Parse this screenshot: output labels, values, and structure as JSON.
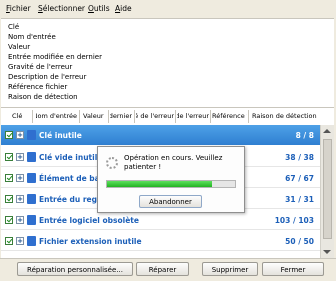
{
  "menu": {
    "fichier": {
      "first": "F",
      "rest": "ichier"
    },
    "selectionner": {
      "first": "S",
      "rest": "électionner"
    },
    "outils": {
      "first": "O",
      "rest": "utils"
    },
    "aide": {
      "first": "A",
      "rest": "ide"
    }
  },
  "details": [
    "Clé",
    "Nom d'entrée",
    "Valeur",
    "Entrée modifiée en dernier",
    "Gravité de l'erreur",
    "Description de l'erreur",
    "Référence fichier",
    "Raison de détection"
  ],
  "columns": [
    "Clé",
    "Nom d'entrée",
    "Valeur",
    "Entrée modifiée en dernier",
    "Gravité de l'erreur",
    "Description de l'erreur",
    "Référence fichier",
    "Raison de détection"
  ],
  "rows": [
    {
      "label": "Clé inutile",
      "count": "8 / 8"
    },
    {
      "label": "Clé vide inutile",
      "count": "38 / 38"
    },
    {
      "label": "Élément de base p",
      "count": "67 / 67"
    },
    {
      "label": "Entrée du registre i",
      "count": "31 / 31"
    },
    {
      "label": "Entrée logiciel obsolète",
      "count": "103 / 103"
    },
    {
      "label": "Fichier extension inutile",
      "count": "50 / 50"
    }
  ],
  "dialog": {
    "message": "Opération en cours. Veuillez patienter !",
    "progress": 0.82,
    "cancel_label": "Abandonner"
  },
  "buttons": {
    "custom_repair": "Réparation personnalisée...",
    "repair": "Réparer",
    "delete": "Supprimer",
    "close": "Fermer"
  },
  "colors": {
    "selected_row": "#2f7fd1",
    "row_text": "#1c5fb8",
    "progress": "#22b322"
  }
}
